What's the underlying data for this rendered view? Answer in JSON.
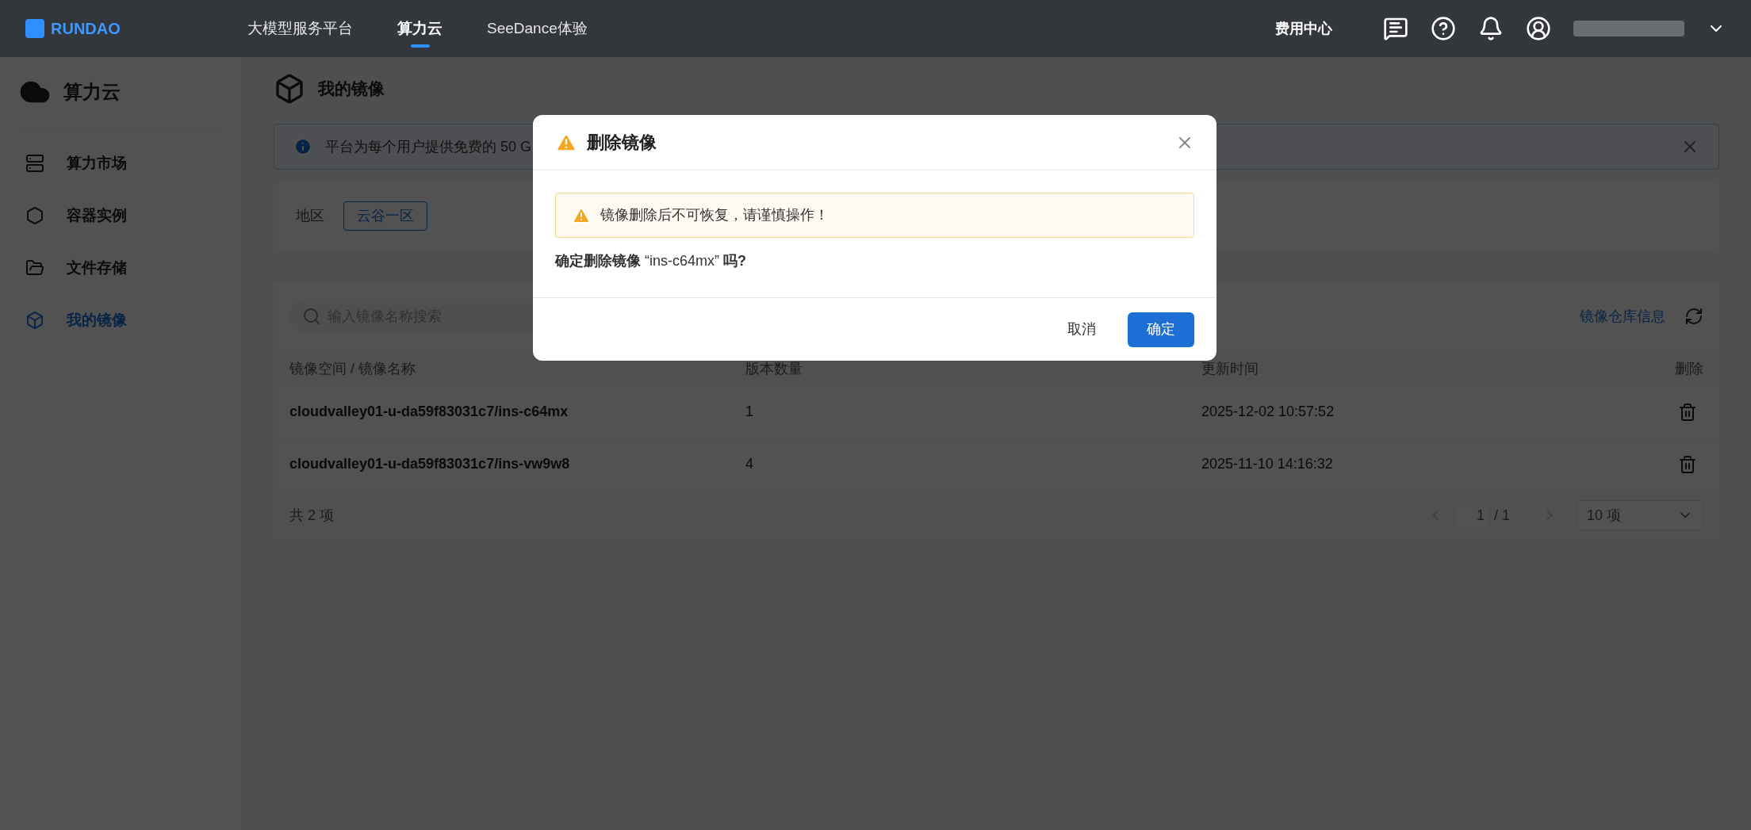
{
  "topbar": {
    "logo": "RUNDAO",
    "nav": [
      {
        "label": "大模型服务平台",
        "selected": false
      },
      {
        "label": "算力云",
        "selected": true
      },
      {
        "label": "SeeDance体验",
        "selected": false
      }
    ],
    "billing": "费用中心"
  },
  "sidebar": {
    "title": "算力云",
    "items": [
      {
        "label": "算力市场",
        "selected": false
      },
      {
        "label": "容器实例",
        "selected": false
      },
      {
        "label": "文件存储",
        "selected": false
      },
      {
        "label": "我的镜像",
        "selected": true
      }
    ]
  },
  "page": {
    "title": "我的镜像",
    "notice": "平台为每个用户提供免费的 50 G",
    "region_label": "地区",
    "regions": [
      {
        "label": "云谷一区",
        "selected": true
      }
    ]
  },
  "table": {
    "search_placeholder": "输入镜像名称搜索",
    "repo_link": "镜像仓库信息",
    "columns": [
      "镜像空间 / 镜像名称",
      "版本数量",
      "更新时间",
      "删除"
    ],
    "rows": [
      {
        "name": "cloudvalley01-u-da59f83031c7/ins-c64mx",
        "versions": "1",
        "updated": "2025-12-02 10:57:52"
      },
      {
        "name": "cloudvalley01-u-da59f83031c7/ins-vw9w8",
        "versions": "4",
        "updated": "2025-11-10 14:16:32"
      }
    ],
    "total": "共 2 项",
    "page": "1",
    "pages": "/ 1",
    "page_size": "10 项"
  },
  "dialog": {
    "title": "删除镜像",
    "warning": "镜像删除后不可恢复，请谨慎操作！",
    "question": "**确定删除镜像** “ins-c64mx” **吗?**",
    "cancel": "取消",
    "confirm": "确定"
  }
}
